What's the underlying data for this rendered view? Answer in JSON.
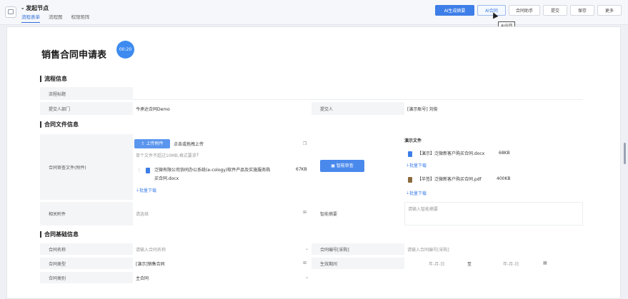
{
  "header": {
    "node_title": "- 发起节点",
    "tabs": [
      "流程表单",
      "流程图",
      "权限矩阵"
    ],
    "buttons": {
      "ai_generate": "AI生成摘要",
      "ai_contract": "AI合同",
      "contract_helper": "合同助手",
      "submit": "提交",
      "save": "保存",
      "more": "更多"
    },
    "tooltip": "AI合同"
  },
  "form": {
    "title": "销售合同申请表",
    "timer": "00:20",
    "sections": {
      "flow_info": "流程信息",
      "contract_files": "合同文件信息",
      "contract_basic": "合同基础信息"
    },
    "flow": {
      "title_label": "流程标题",
      "title_value": "",
      "dept_label": "提交人部门",
      "dept_value": "今承达合同Demo",
      "submitter_label": "提交人",
      "submitter_value": "[演示账号] 刘俊"
    },
    "files": {
      "review_label": "合同审查文件(附件)",
      "upload_button": "上传附件",
      "upload_hint": "点击或拖拽上传",
      "size_hint": "单个文件不超过10MB,格式要求",
      "file_name_line1": "泛微有限公司协同办公系统(e-cology)软件产品及实施服务购",
      "file_name_line2": "买合同.docx",
      "file_size": "67KB",
      "batch_download": "批量下载",
      "intelligent_review": "智能审查",
      "demo_files_label": "演示文件",
      "demo_file_1": "【演示】泛微新客户购买合同.docx",
      "demo_file_1_size": "68KB",
      "demo_file_2": "【半签】泛微新客户购买合同.pdf",
      "demo_file_2_size": "400KB",
      "demo_batch_download_1": "批量下载",
      "demo_batch_download_2": "批量下载",
      "other_attach_label": "相关附件",
      "other_attach_placeholder": "请选择",
      "summary_label": "智能摘要",
      "summary_placeholder": "请输入智能摘要"
    },
    "basic": {
      "name_label": "合同名称",
      "name_placeholder": "请输入合同名称",
      "number_label": "合同编号[采购]",
      "number_placeholder": "请输入合同编号[采购]",
      "type_label": "合同类型",
      "type_value": "[演示]销售合同",
      "period_label": "生效期间",
      "period_start": "年-月-日",
      "period_sep": "至",
      "period_end": "年-月-日",
      "category_label": "合同类别",
      "category_value": "主合同"
    }
  }
}
